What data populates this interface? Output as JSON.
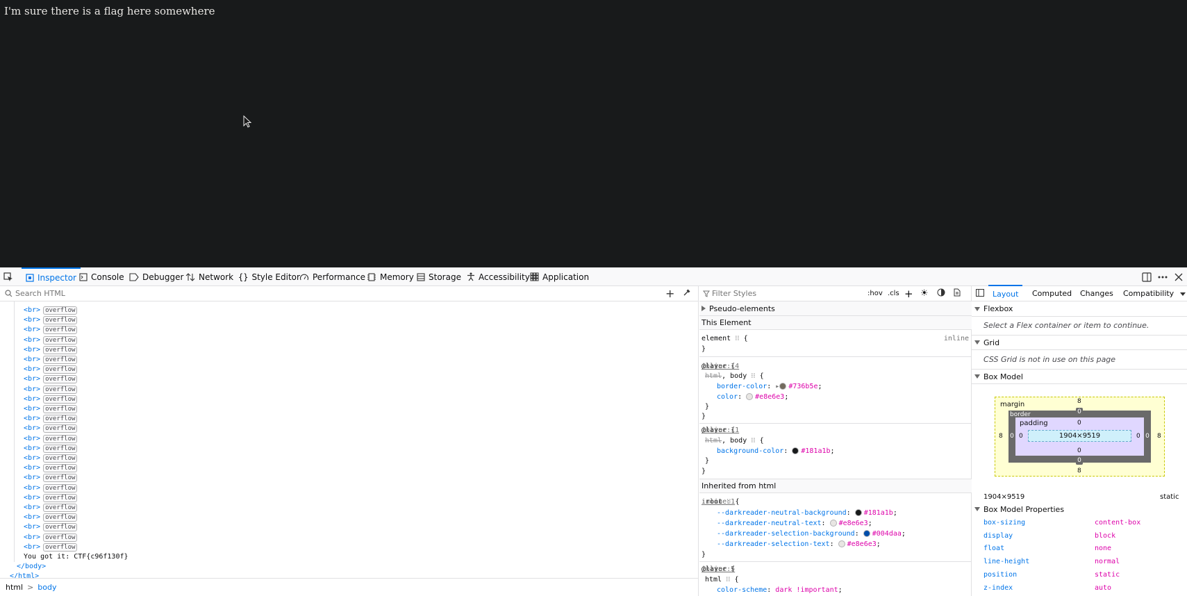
{
  "page": {
    "text": "I'm sure there is a flag here somewhere"
  },
  "devtools": {
    "tabs": [
      {
        "label": "Inspector"
      },
      {
        "label": "Console"
      },
      {
        "label": "Debugger"
      },
      {
        "label": "Network"
      },
      {
        "label": "Style Editor"
      },
      {
        "label": "Performance"
      },
      {
        "label": "Memory"
      },
      {
        "label": "Storage"
      },
      {
        "label": "Accessibility"
      },
      {
        "label": "Application"
      }
    ],
    "inspector": {
      "search_placeholder": "Search HTML",
      "br_tag": "<br>",
      "overflow_badge": "overflow",
      "flag_text": "You got it: CTF{c96f130f}",
      "body_close": "</body>",
      "html_close": "</html>",
      "breadcrumbs": [
        "html",
        "body"
      ],
      "breadcrumb_sep": ">"
    },
    "rules": {
      "filter_placeholder": "Filter Styles",
      "hov": ":hov",
      "cls": ".cls",
      "pseudo_elements": "Pseudo-elements",
      "this_element": "This Element",
      "element_selector": "element",
      "inline_label": "inline",
      "layer_kw": "@layer",
      "strike_html": "html",
      "body_sel": ", body",
      "prop_border_color": "border-color",
      "val_border_color": "#736b5e",
      "prop_color": "color",
      "val_color": "#e8e6e3",
      "src_14": "inline:14",
      "src_11": "inline:11",
      "prop_bg": "background-color",
      "val_bg": "#181a1b",
      "inherited": "Inherited from html",
      "root_sel": ":root",
      "src_1": "inline:1",
      "var1_name": "--darkreader-neutral-background",
      "var1_val": "#181a1b",
      "var2_name": "--darkreader-neutral-text",
      "var2_val": "#e8e6e3",
      "var3_name": "--darkreader-selection-background",
      "var3_val": "#004daa",
      "var4_name": "--darkreader-selection-text",
      "var4_val": "#e8e6e3",
      "src_5": "inline:5",
      "html_sel": "html",
      "prop_scheme": "color-scheme",
      "val_scheme": "dark !important"
    },
    "layout": {
      "tabs": [
        "Layout",
        "Computed",
        "Changes",
        "Compatibility"
      ],
      "flexbox": "Flexbox",
      "flex_note": "Select a Flex container or item to continue.",
      "grid": "Grid",
      "grid_note": "CSS Grid is not in use on this page",
      "box_model": "Box Model",
      "margin_label": "margin",
      "border_label": "border",
      "padding_label": "padding",
      "content_size": "1904×9519",
      "margin_value": "8",
      "zero": "0",
      "dims": "1904×9519",
      "position_static": "static",
      "props_header": "Box Model Properties",
      "props": [
        {
          "key": "box-sizing",
          "value": "content-box"
        },
        {
          "key": "display",
          "value": "block"
        },
        {
          "key": "float",
          "value": "none"
        },
        {
          "key": "line-height",
          "value": "normal"
        },
        {
          "key": "position",
          "value": "static"
        },
        {
          "key": "z-index",
          "value": "auto"
        }
      ]
    }
  },
  "colors": {
    "accent": "#0074e8",
    "page_bg": "#181a1b",
    "page_text": "#e8e6e3",
    "value_pink": "#dd00a9"
  }
}
